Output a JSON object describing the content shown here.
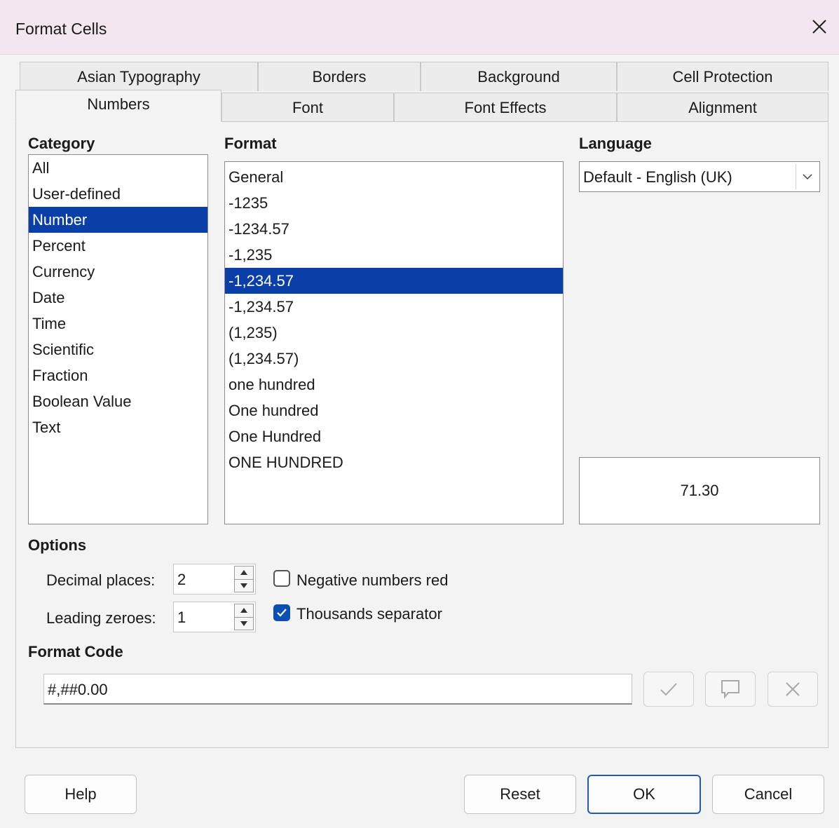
{
  "window": {
    "title": "Format Cells"
  },
  "tabs": {
    "row1": [
      {
        "label": "Asian Typography"
      },
      {
        "label": "Borders"
      },
      {
        "label": "Background"
      },
      {
        "label": "Cell Protection"
      }
    ],
    "row2": [
      {
        "label": "Numbers",
        "active": true
      },
      {
        "label": "Font"
      },
      {
        "label": "Font Effects"
      },
      {
        "label": "Alignment"
      }
    ]
  },
  "category": {
    "label": "Category",
    "items": [
      "All",
      "User-defined",
      "Number",
      "Percent",
      "Currency",
      "Date",
      "Time",
      "Scientific",
      "Fraction",
      "Boolean Value",
      "Text"
    ],
    "selected": "Number"
  },
  "format": {
    "label": "Format",
    "items": [
      "General",
      "-1235",
      "-1234.57",
      "-1,235",
      "-1,234.57",
      "-1,234.57",
      "(1,235)",
      "(1,234.57)",
      "one hundred",
      "One hundred",
      "One Hundred",
      "ONE HUNDRED"
    ],
    "selected_index": 4
  },
  "language": {
    "label": "Language",
    "value": "Default - English (UK)"
  },
  "preview": {
    "value": "71.30"
  },
  "options": {
    "label": "Options",
    "decimal_places_label": "Decimal places:",
    "decimal_places_value": "2",
    "leading_zeroes_label": "Leading zeroes:",
    "leading_zeroes_value": "1",
    "negative_red_label": "Negative numbers red",
    "negative_red_checked": false,
    "thousands_sep_label": "Thousands separator",
    "thousands_sep_checked": true
  },
  "format_code": {
    "label": "Format Code",
    "value": "#,##0.00"
  },
  "buttons": {
    "help": "Help",
    "reset": "Reset",
    "ok": "OK",
    "cancel": "Cancel"
  },
  "colors": {
    "selection": "#0b3fa8",
    "checkbox": "#0b4fb3",
    "titlebar": "#f3e6f0"
  }
}
